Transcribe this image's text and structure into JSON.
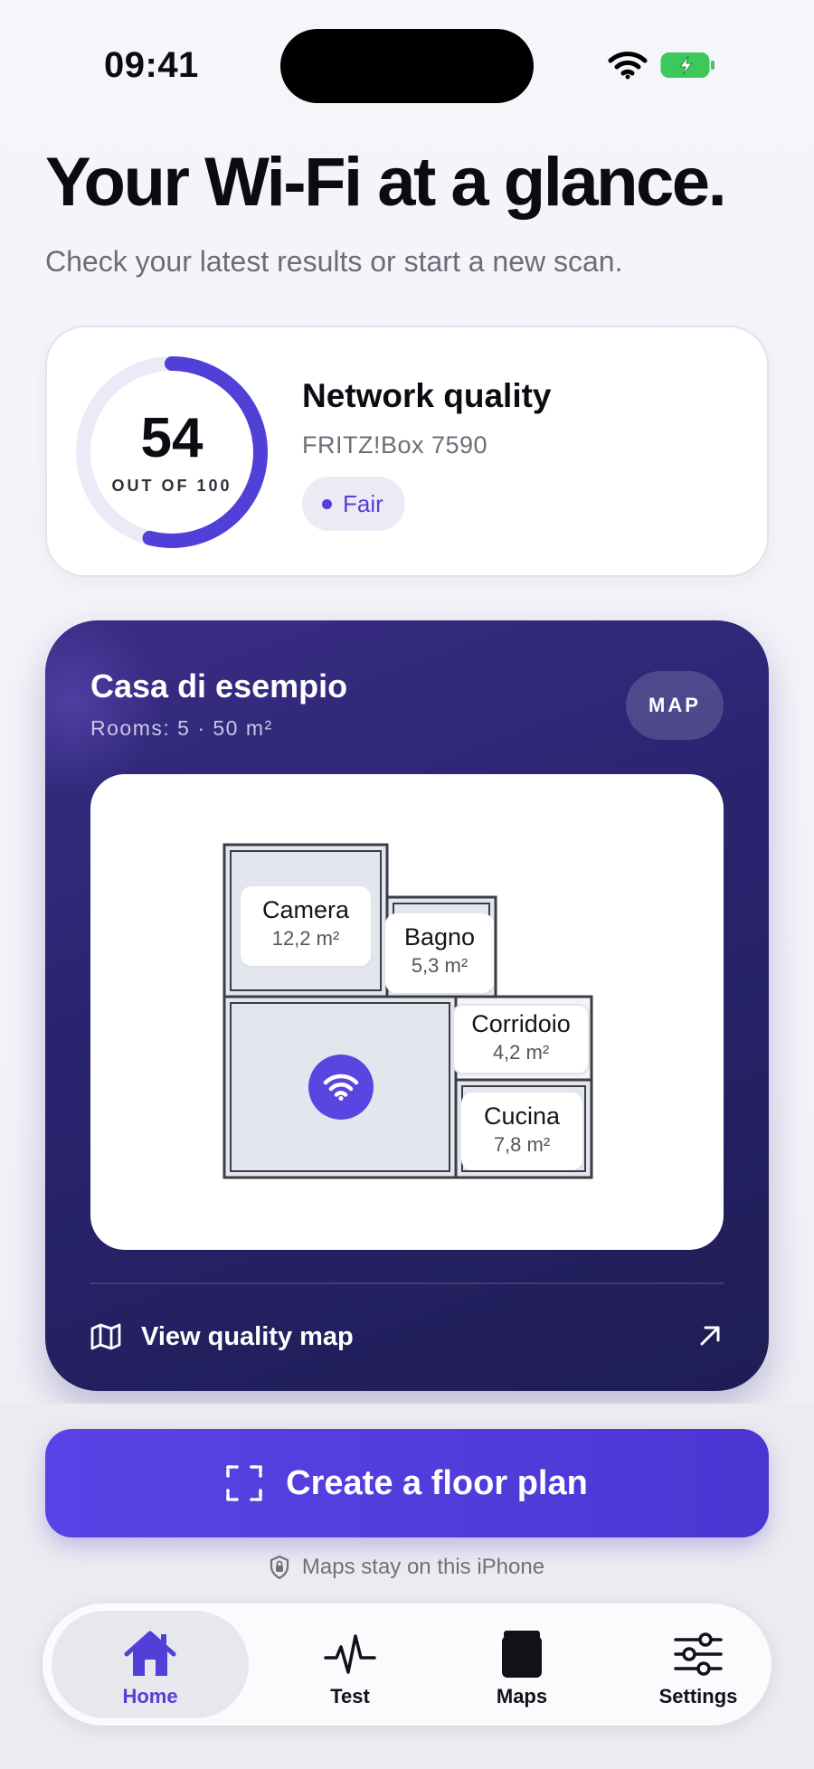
{
  "status_bar": {
    "time": "09:41"
  },
  "header": {
    "title": "Your Wi-Fi at a glance.",
    "subtitle": "Check your latest results or start a new scan."
  },
  "quality": {
    "score": "54",
    "score_caption": "OUT OF 100",
    "score_fraction": 0.54,
    "title": "Network quality",
    "router": "FRITZ!Box 7590",
    "status": "Fair"
  },
  "home": {
    "name": "Casa di esempio",
    "meta": "Rooms: 5 · 50 m²",
    "map_chip": "MAP",
    "rooms": [
      {
        "name": "Camera",
        "area": "12,2 m²"
      },
      {
        "name": "Bagno",
        "area": "5,3 m²"
      },
      {
        "name": "Corridoio",
        "area": "4,2 m²"
      },
      {
        "name": "Cucina",
        "area": "7,8 m²"
      }
    ],
    "view_map_label": "View quality map"
  },
  "actions": {
    "create_label": "Create a floor plan",
    "privacy_note": "Maps stay on this iPhone"
  },
  "tabs": [
    {
      "label": "Home",
      "icon": "house-icon",
      "active": true
    },
    {
      "label": "Test",
      "icon": "pulse-icon",
      "active": false
    },
    {
      "label": "Maps",
      "icon": "maps-icon",
      "active": false
    },
    {
      "label": "Settings",
      "icon": "sliders-icon",
      "active": false
    }
  ],
  "colors": {
    "accent": "#5140d8",
    "card_dark": "#2a2470",
    "battery_green": "#3cc85a"
  }
}
